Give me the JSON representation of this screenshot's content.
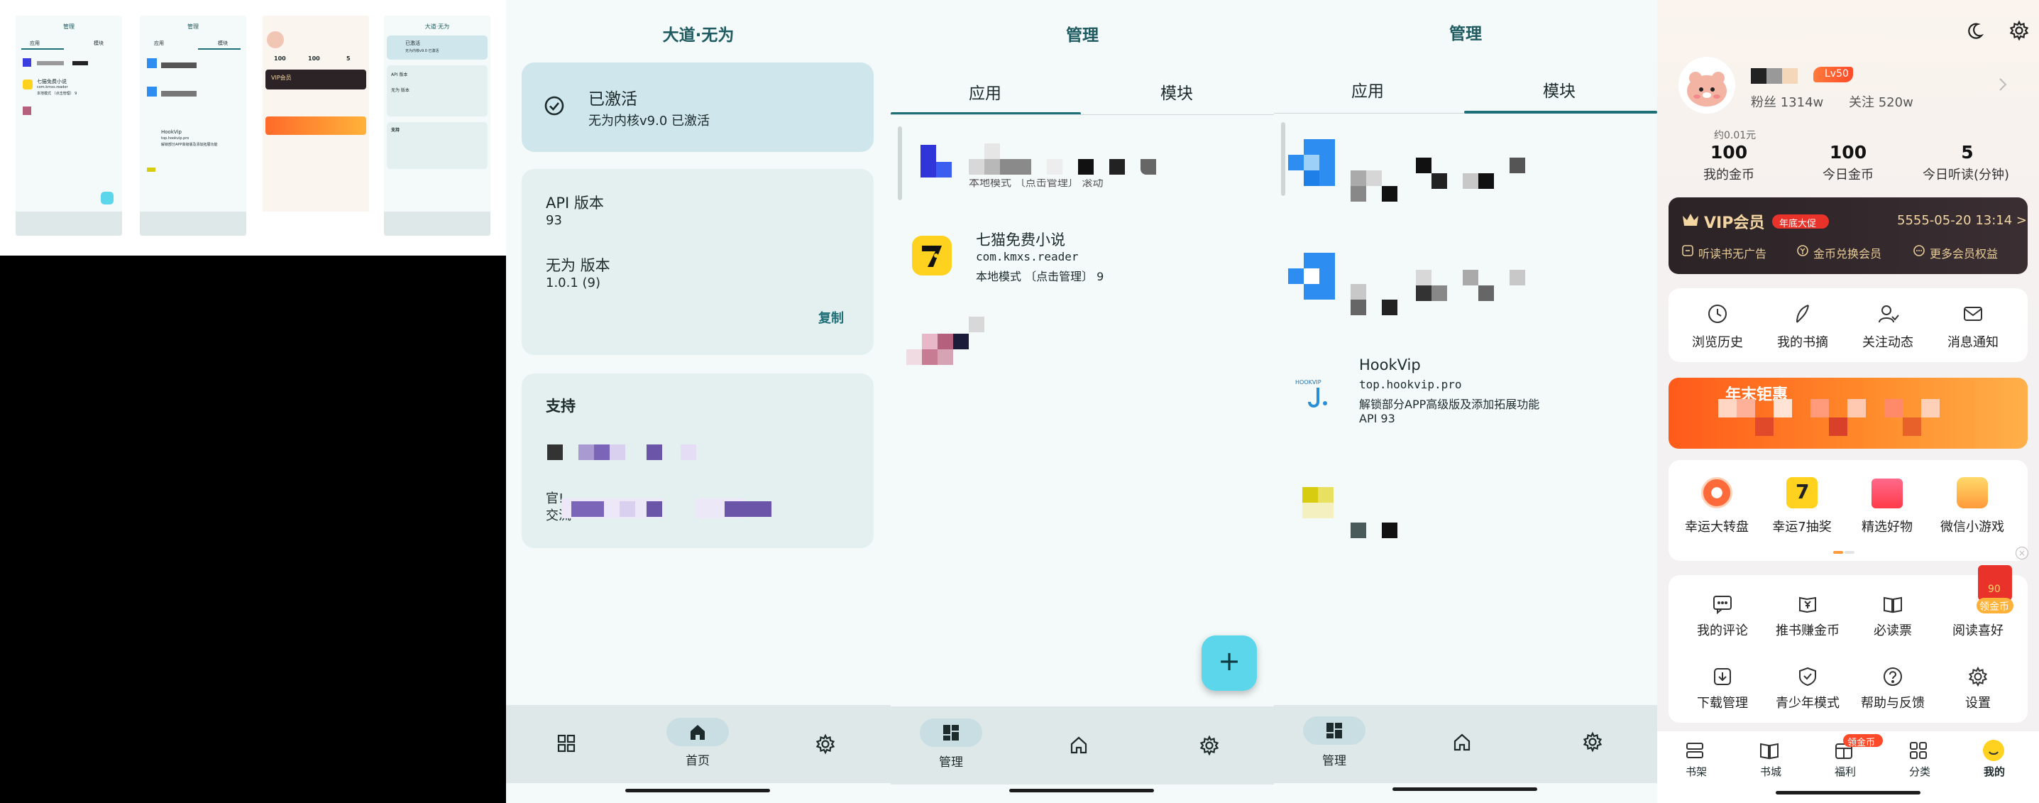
{
  "thumbnails": {
    "t1": {
      "title": "管理",
      "tab_apps": "应用",
      "tab_modules": "模块",
      "item_name": "七猫免费小说",
      "item_pkg": "com.kmxs.reader",
      "item_mode": "本地模式 〔点击管理〕 9"
    },
    "t2": {
      "title": "管理",
      "tab_apps": "应用",
      "tab_modules": "模块",
      "item_name": "HookVip",
      "item_pkg": "top.hookvip.pro",
      "item_desc": "解锁部分APP高级版及添加拓展功能"
    },
    "t3": {
      "stat1": "100",
      "stat2": "100",
      "stat3": "5",
      "vip": "VIP会员"
    },
    "t4": {
      "title": "大道·无为",
      "status": "已激活",
      "status_sub": "无为内核v9.0 已激活",
      "api_label": "API 版本",
      "ver_label": "无为 版本",
      "support": "支持"
    }
  },
  "main": {
    "title": "大道·无为",
    "status_title": "已激活",
    "status_sub": "无为内核v9.0 已激活",
    "api_label": "API 版本",
    "api_value": "93",
    "ver_label": "无为 版本",
    "ver_value": "1.0.1 (9)",
    "copy": "复制",
    "support": "支持",
    "official_prefix": "官!",
    "exchange_prefix": "交流",
    "nav_home": "首页"
  },
  "manage_apps": {
    "title": "管理",
    "tab_apps": "应用",
    "tab_modules": "模块",
    "item1_line2": "本地模式 〔点击管理〕 滚动",
    "item2_name": "七猫免费小说",
    "item2_pkg": "com.kmxs.reader",
    "item2_mode": "本地模式 〔点击管理〕 9",
    "nav_manage": "管理",
    "fab": "+"
  },
  "manage_modules": {
    "title": "管理",
    "tab_apps": "应用",
    "tab_modules": "模块",
    "hook_name": "HookVip",
    "hook_pkg": "top.hookvip.pro",
    "hook_desc": "解锁部分APP高级版及添加拓展功能",
    "hook_api": "API 93",
    "hook_logo_text": "HOOKVIP",
    "nav_manage": "管理"
  },
  "reader": {
    "level": "Lv50",
    "fans": "粉丝 1314w",
    "follow": "关注 520w",
    "coin_hint": "约0.01元",
    "stats": [
      {
        "value": "100",
        "label": "我的金币"
      },
      {
        "value": "100",
        "label": "今日金币"
      },
      {
        "value": "5",
        "label": "今日听读(分钟)"
      }
    ],
    "vip_title": "VIP会员",
    "vip_badge": "年底大促",
    "vip_expire": "5555-05-20 13:14 >",
    "vip_perks": [
      "听读书无广告",
      "金币兑换会员",
      "更多会员权益"
    ],
    "quick": [
      "浏览历史",
      "我的书摘",
      "关注动态",
      "消息通知"
    ],
    "banner_text": "年末钜惠",
    "games": [
      "幸运大转盘",
      "幸运7抽奖",
      "精选好物",
      "微信小游戏"
    ],
    "grid_row1": [
      "我的评论",
      "推书赚金币",
      "必读票",
      "阅读喜好"
    ],
    "grid_row2": [
      "下载管理",
      "青少年模式",
      "帮助与反馈",
      "设置"
    ],
    "float_coin": "90",
    "float_label": "领金币",
    "tabs": [
      "书架",
      "书城",
      "福利",
      "分类",
      "我的"
    ],
    "tab_badge": "领金币"
  },
  "colors": {
    "mint_bg": "#f3faf9",
    "teal_title": "#1e5a60",
    "activated_card": "#cfe7ec",
    "info_card": "#e4eff0",
    "fab": "#5bd6ea",
    "vip_dark": "#2b2326",
    "orange": "#ff6a2a"
  }
}
